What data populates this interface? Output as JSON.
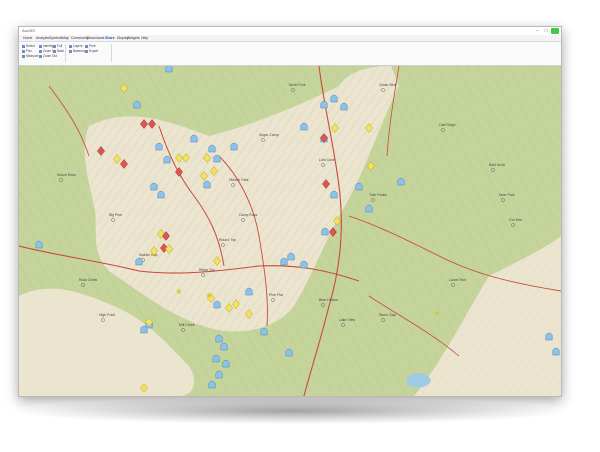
{
  "window": {
    "title": "ArcGIS"
  },
  "menu": {
    "items": [
      "Home",
      "Analysis",
      "Symbols",
      "Map",
      "Community",
      "Downloads",
      "Share",
      "Display",
      "Widgets",
      "Help"
    ],
    "active_index": 6
  },
  "ribbon": {
    "items": [
      "Select",
      "Pan",
      "Measure",
      "Identify",
      "Zoom In",
      "Zoom Out",
      "Full",
      "Back",
      "Layers",
      "Basemap",
      "Print",
      "Export"
    ]
  },
  "colors": {
    "lowland": "#c4d49a",
    "highland": "#ebe4cf",
    "road": "#c94a3c",
    "water": "#9ecae6",
    "shelter_marker": "#8cc2e8",
    "summit_marker": "#f2e35a",
    "hazard_marker": "#dd5552"
  },
  "map": {
    "place_labels": [
      "Mount Ross",
      "Big Pine",
      "Hidden Falls",
      "Camp Ross",
      "Saddle Gap",
      "Ridge Top",
      "Pine Flat",
      "Bear Hollow",
      "Rock Creek",
      "Lake View",
      "North Fork",
      "Cedar Bluff",
      "Lost Cove",
      "Twin Peaks",
      "Bald Knob",
      "Deer Park",
      "Stone Gap",
      "Laurel Run",
      "Fox Den",
      "Mill Creek",
      "High Point",
      "Round Top",
      "Sugar Camp",
      "Oak Ridge"
    ]
  }
}
